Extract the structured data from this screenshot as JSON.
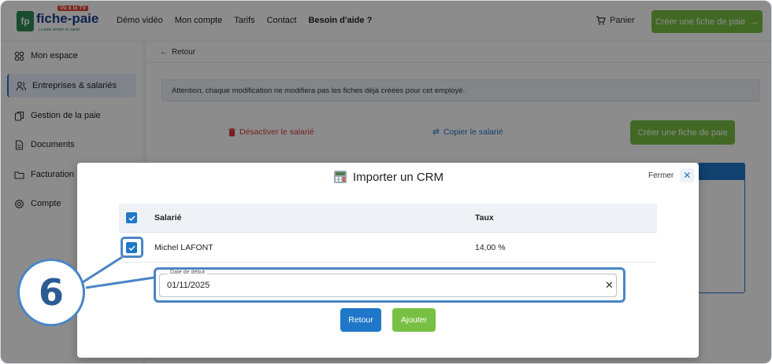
{
  "header": {
    "logo_name": "fiche-paie",
    "logo_badge": "fp",
    "logo_tv": "Vu à la TV",
    "logo_tagline": "La paie simple et rapide",
    "nav": [
      "Démo vidéo",
      "Mon compte",
      "Tarifs",
      "Contact",
      "Besoin d'aide ?"
    ],
    "cart_label": "Panier",
    "create_label": "Créer une fiche de paie"
  },
  "sidebar": {
    "items": [
      {
        "label": "Mon espace",
        "icon": "grid-icon"
      },
      {
        "label": "Entreprises & salariés",
        "icon": "users-icon"
      },
      {
        "label": "Gestion de la paie",
        "icon": "copy-icon"
      },
      {
        "label": "Documents",
        "icon": "document-icon"
      },
      {
        "label": "Facturation",
        "icon": "folder-icon"
      },
      {
        "label": "Compte",
        "icon": "gear-icon"
      }
    ]
  },
  "main": {
    "back_label": "Retour",
    "warning": "Attention, chaque modification ne modifiera pas les fiches déjà créées pour cet employé.",
    "deactivate_label": "Désactiver le salarié",
    "copy_label": "Copier le salarié",
    "create_label": "Créer une fiche de paie"
  },
  "modal": {
    "title": "Importer un CRM",
    "close_label": "Fermer",
    "columns": {
      "employee": "Salarié",
      "rate": "Taux"
    },
    "rows": [
      {
        "employee": "Michel LAFONT",
        "rate": "14,00 %"
      }
    ],
    "start_date": {
      "label": "Date de début",
      "value": "01/11/2025"
    },
    "back_button": "Retour",
    "add_button": "Ajouter"
  },
  "callout": {
    "step": "6"
  },
  "colors": {
    "primary": "#1f77c9",
    "green": "#78c043",
    "danger": "#d63a3a",
    "highlight": "#4a86c5"
  }
}
